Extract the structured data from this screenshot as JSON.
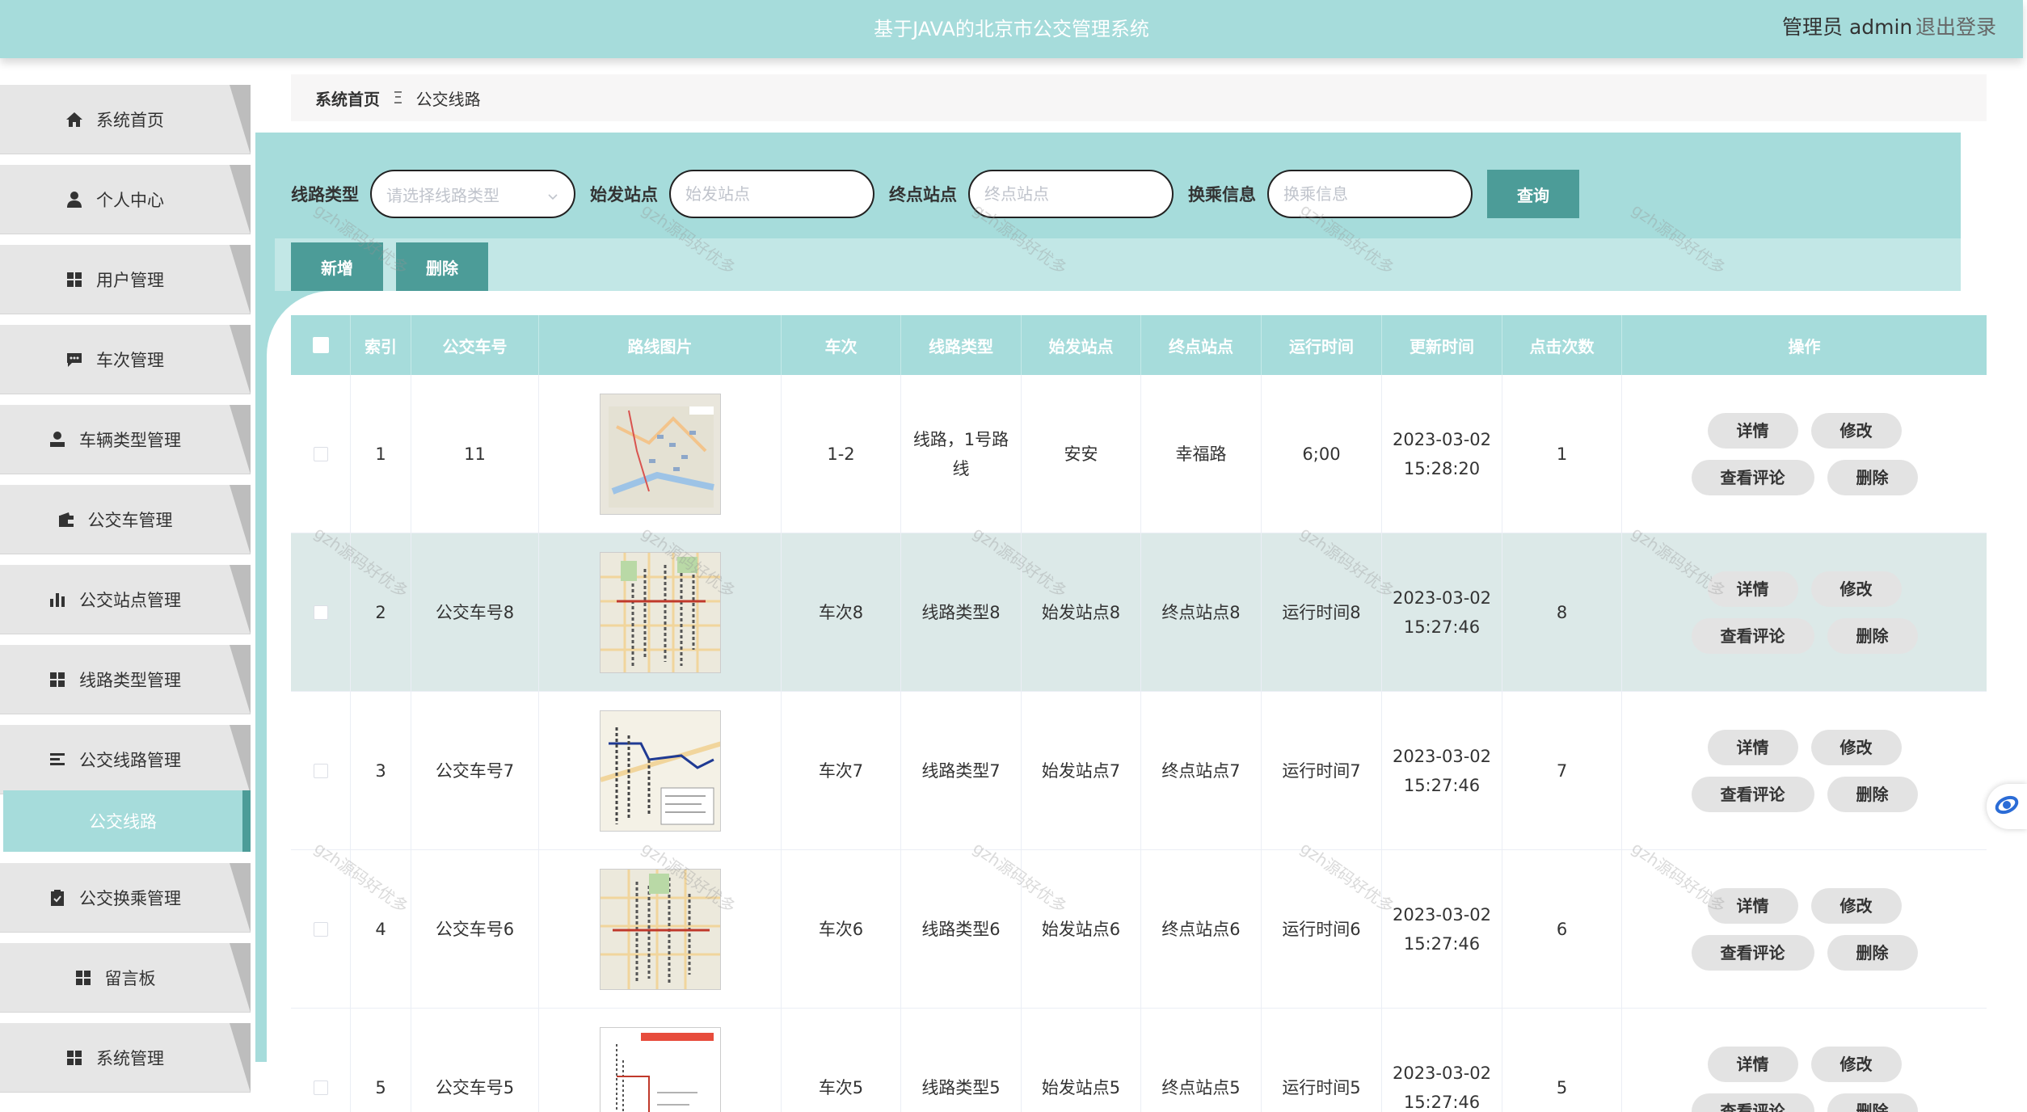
{
  "header": {
    "title": "基于JAVA的北京市公交管理系统",
    "user": "管理员 admin",
    "logout": "退出登录"
  },
  "sidebar": {
    "items": [
      {
        "label": "系统首页",
        "icon": "home-icon"
      },
      {
        "label": "个人中心",
        "icon": "user-icon"
      },
      {
        "label": "用户管理",
        "icon": "grid-icon"
      },
      {
        "label": "车次管理",
        "icon": "chat-icon"
      },
      {
        "label": "车辆类型管理",
        "icon": "person-icon"
      },
      {
        "label": "公交车管理",
        "icon": "wallet-icon"
      },
      {
        "label": "公交站点管理",
        "icon": "bar-chart-icon"
      },
      {
        "label": "线路类型管理",
        "icon": "grid-icon"
      },
      {
        "label": "公交线路管理",
        "icon": "list-icon"
      },
      {
        "label": "公交换乘管理",
        "icon": "clipboard-icon"
      },
      {
        "label": "留言板",
        "icon": "grid-icon"
      },
      {
        "label": "系统管理",
        "icon": "grid-icon"
      }
    ],
    "active_sub": "公交线路"
  },
  "breadcrumb": {
    "home": "系统首页",
    "separator": "Ξ",
    "current": "公交线路"
  },
  "search": {
    "route_type_label": "线路类型",
    "route_type_placeholder": "请选择线路类型",
    "start_label": "始发站点",
    "start_placeholder": "始发站点",
    "end_label": "终点站点",
    "end_placeholder": "终点站点",
    "transfer_label": "换乘信息",
    "transfer_placeholder": "换乘信息",
    "query_button": "查询"
  },
  "actions": {
    "add": "新增",
    "delete": "删除"
  },
  "table": {
    "columns": [
      "索引",
      "公交车号",
      "路线图片",
      "车次",
      "线路类型",
      "始发站点",
      "终点站点",
      "运行时间",
      "更新时间",
      "点击次数",
      "操作"
    ],
    "rows": [
      {
        "index": "1",
        "bus": "11",
        "trip": "1-2",
        "type": "线路，1号路线",
        "start": "安安",
        "end": "幸福路",
        "time": "6;00",
        "updated_date": "2023-03-02",
        "updated_time": "15:28:20",
        "clicks": "1"
      },
      {
        "index": "2",
        "bus": "公交车号8",
        "trip": "车次8",
        "type": "线路类型8",
        "start": "始发站点8",
        "end": "终点站点8",
        "time": "运行时间8",
        "updated_date": "2023-03-02",
        "updated_time": "15:27:46",
        "clicks": "8"
      },
      {
        "index": "3",
        "bus": "公交车号7",
        "trip": "车次7",
        "type": "线路类型7",
        "start": "始发站点7",
        "end": "终点站点7",
        "time": "运行时间7",
        "updated_date": "2023-03-02",
        "updated_time": "15:27:46",
        "clicks": "7"
      },
      {
        "index": "4",
        "bus": "公交车号6",
        "trip": "车次6",
        "type": "线路类型6",
        "start": "始发站点6",
        "end": "终点站点6",
        "time": "运行时间6",
        "updated_date": "2023-03-02",
        "updated_time": "15:27:46",
        "clicks": "6"
      },
      {
        "index": "5",
        "bus": "公交车号5",
        "trip": "车次5",
        "type": "线路类型5",
        "start": "始发站点5",
        "end": "终点站点5",
        "time": "运行时间5",
        "updated_date": "2023-03-02",
        "updated_time": "15:27:46",
        "clicks": "5"
      }
    ],
    "ops": {
      "detail": "详情",
      "edit": "修改",
      "comments": "查看评论",
      "delete": "删除"
    }
  },
  "watermark": "gzh源码好优多"
}
